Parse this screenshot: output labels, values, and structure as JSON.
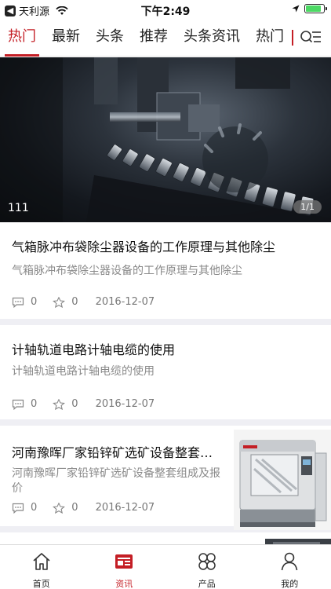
{
  "status_bar": {
    "back_glyph": "◀",
    "carrier": "天利源",
    "time": "下午2:49",
    "battery_level": 0.85,
    "icons": [
      "back-box-icon",
      "wifi-icon",
      "location-arrow-icon",
      "battery-icon"
    ]
  },
  "tabs": [
    {
      "label": "热门",
      "active": true
    },
    {
      "label": "最新",
      "active": false
    },
    {
      "label": "头条",
      "active": false
    },
    {
      "label": "推荐",
      "active": false
    },
    {
      "label": "头条资讯",
      "active": false
    },
    {
      "label": "热门",
      "active": false
    }
  ],
  "hero": {
    "caption": "111",
    "counter": "1/1"
  },
  "articles": [
    {
      "title": "气箱脉冲布袋除尘器设备的工作原理与其他除尘",
      "summary": "气箱脉冲布袋除尘器设备的工作原理与其他除尘",
      "comments": "0",
      "favorites": "0",
      "date": "2016-12-07"
    },
    {
      "title": "计轴轨道电路计轴电缆的使用",
      "summary": "计轴轨道电路计轴电缆的使用",
      "comments": "0",
      "favorites": "0",
      "date": "2016-12-07"
    },
    {
      "title": "河南豫晖厂家铅锌矿选矿设备整套组成及报价",
      "summary": "河南豫晖厂家铅锌矿选矿设备整套组成及报价",
      "comments": "0",
      "favorites": "0",
      "date": "2016-12-07"
    }
  ],
  "bottom_nav": [
    {
      "label": "首页",
      "icon": "home-icon",
      "active": false
    },
    {
      "label": "资讯",
      "icon": "news-icon",
      "active": true
    },
    {
      "label": "产品",
      "icon": "products-icon",
      "active": false
    },
    {
      "label": "我的",
      "icon": "profile-icon",
      "active": false
    }
  ],
  "colors": {
    "accent": "#c41e25",
    "text": "#222222",
    "muted": "#8a8a8a",
    "separator": "#efeff4"
  }
}
